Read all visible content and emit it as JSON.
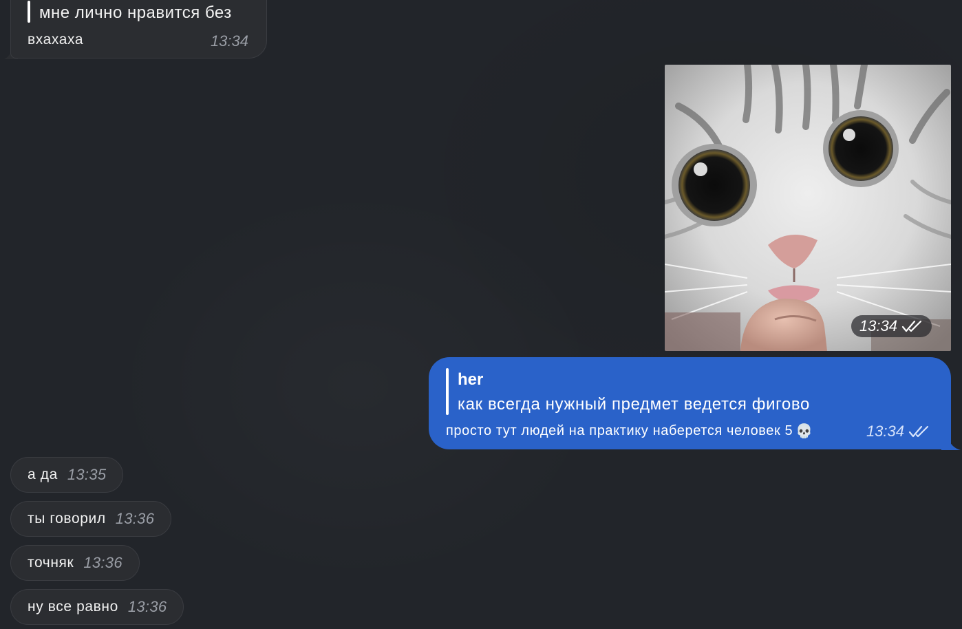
{
  "top_message": {
    "quote_text": "мне лично нравится без",
    "text": "вхахаха",
    "time": "13:34"
  },
  "photo_message": {
    "time": "13:34",
    "status_icon": "double-check-icon"
  },
  "reply_message": {
    "quote_author": "her",
    "quote_text": "как всегда нужный предмет ведется фигово",
    "text": "просто тут людей на практику наберется человек 5",
    "emoji": "💀",
    "time": "13:34",
    "status_icon": "double-check-icon"
  },
  "incoming_messages": [
    {
      "text": "а да",
      "time": "13:35"
    },
    {
      "text": "ты говорил",
      "time": "13:36"
    },
    {
      "text": "точняк",
      "time": "13:36"
    },
    {
      "text": "ну все равно",
      "time": "13:36"
    }
  ],
  "colors": {
    "background": "#22252a",
    "incoming_bubble": "#2b2d31",
    "outgoing_bubble": "#2a62c9"
  }
}
